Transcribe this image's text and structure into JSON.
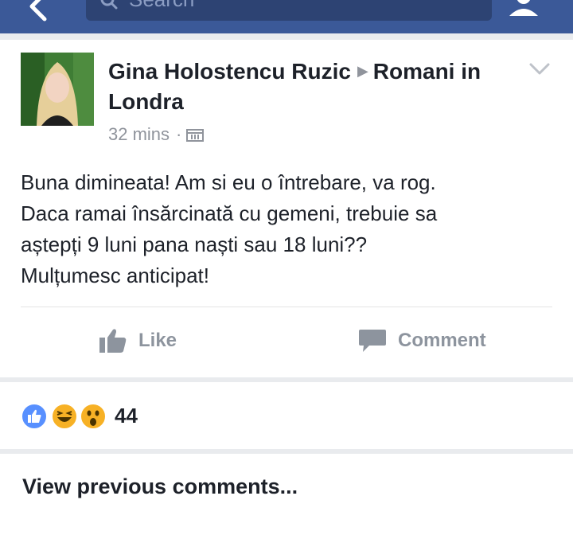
{
  "topbar": {
    "search_placeholder": "Search",
    "color": "#3b5998"
  },
  "post": {
    "author": "Gina Holostencu Ruzic",
    "group": "Romani in Londra",
    "time": "32 mins",
    "body_lines": [
      "Buna dimineata! Am si eu o întrebare, va rog.",
      "Daca ramai însărcinată cu gemeni, trebuie sa",
      "aștepți 9 luni pana naști sau 18 luni??",
      "Mulțumesc anticipat!"
    ],
    "like_label": "Like",
    "comment_label": "Comment"
  },
  "reactions": {
    "types": [
      "like-icon",
      "haha-icon",
      "wow-icon"
    ],
    "count": "44"
  },
  "comments": {
    "view_previous": "View previous comments..."
  }
}
